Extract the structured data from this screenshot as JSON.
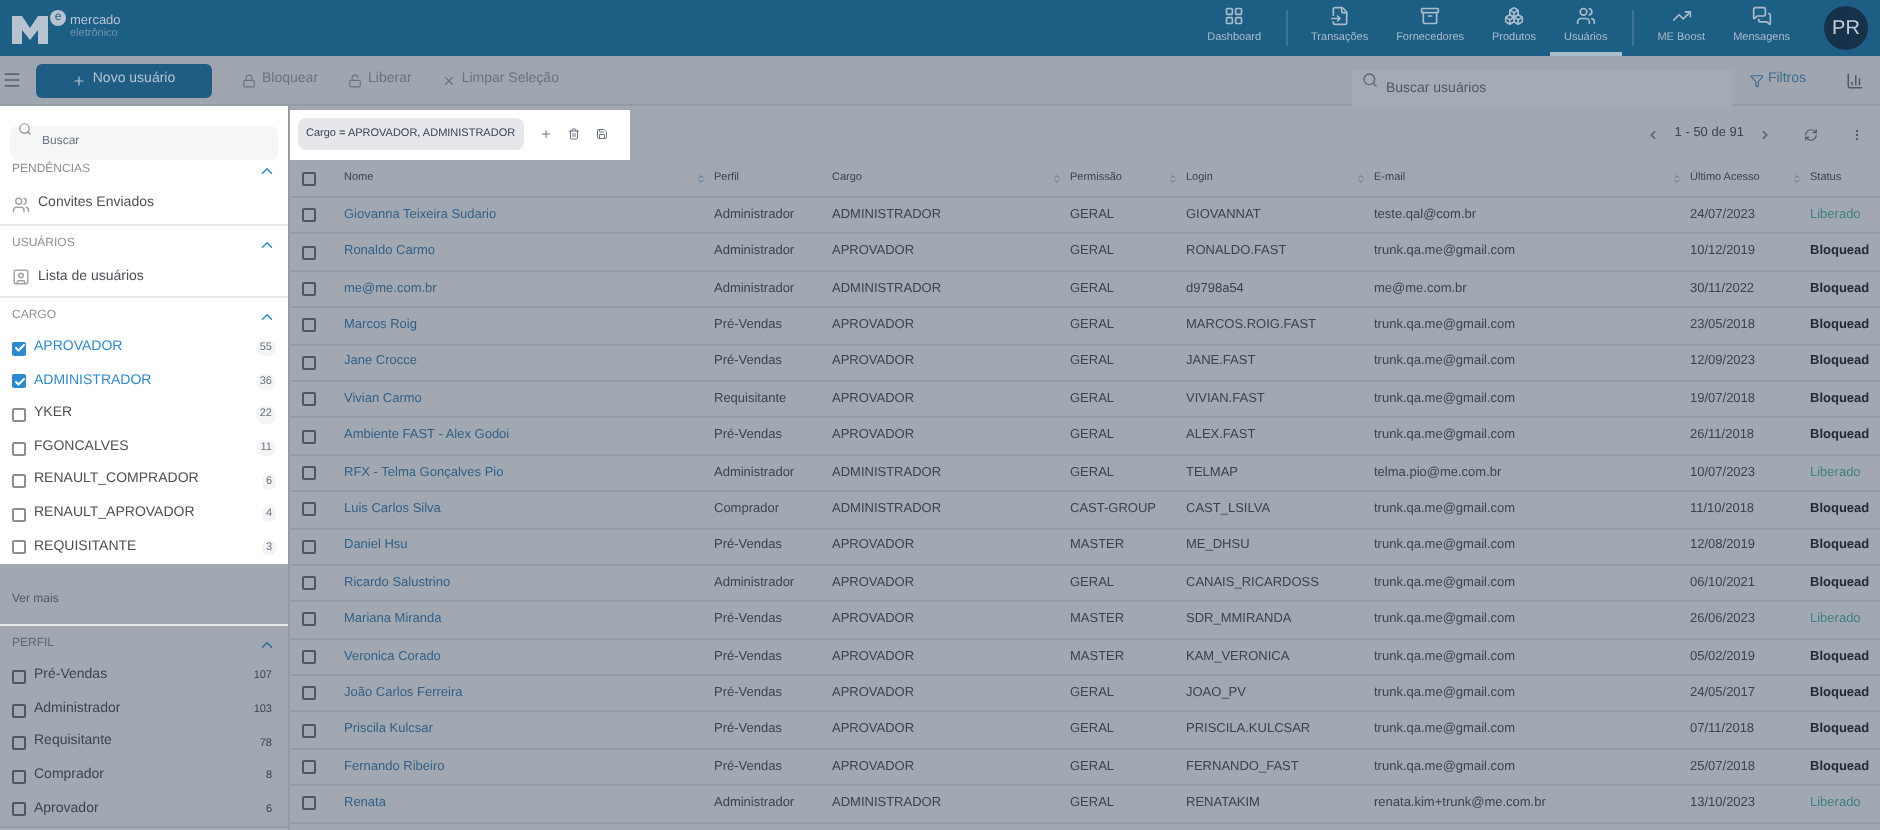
{
  "brand": {
    "line_1": "mercado",
    "line_2": "eletrônico",
    "mark": "e"
  },
  "nav": [
    {
      "label": "Dashboard",
      "selected": false
    },
    {
      "label": "Transações",
      "selected": false
    },
    {
      "label": "Fornecedores",
      "selected": false
    },
    {
      "label": "Produtos",
      "selected": false
    },
    {
      "label": "Usuários",
      "selected": true
    },
    {
      "label": "ME Boost",
      "selected": false
    },
    {
      "label": "Mensagens",
      "selected": false
    }
  ],
  "avatar": "PR",
  "toolbar": {
    "new_button": "Novo usuário",
    "actions": [
      {
        "label": "Bloquear"
      },
      {
        "label": "Liberar"
      },
      {
        "label": "Limpar Seleção"
      }
    ],
    "search": {
      "placeholder": "Buscar usuários"
    },
    "filters": "Filtros"
  },
  "sidebar": {
    "search": {
      "placeholder": "Buscar"
    },
    "sections": [
      {
        "title": "PENDÊNCIAS",
        "highlighted": true,
        "links": [
          {
            "label": "Convites Enviados"
          }
        ]
      },
      {
        "title": "USUÁRIOS",
        "highlighted": true,
        "links": [
          {
            "label": "Lista de usuários"
          }
        ]
      },
      {
        "title": "CARGO",
        "highlighted": true,
        "options": [
          {
            "label": "APROVADOR",
            "count": "55",
            "checked": true
          },
          {
            "label": "ADMINISTRADOR",
            "count": "36",
            "checked": true
          },
          {
            "label": "YKER",
            "count": "22",
            "checked": false
          },
          {
            "label": "FGONCALVES",
            "count": "11",
            "checked": false
          },
          {
            "label": "RENAULT_COMPRADOR",
            "count": "6",
            "checked": false
          },
          {
            "label": "RENAULT_APROVADOR",
            "count": "4",
            "checked": false
          },
          {
            "label": "REQUISITANTE",
            "count": "3",
            "checked": false
          }
        ],
        "more": "Ver mais"
      },
      {
        "title": "PERFIL",
        "highlighted": false,
        "options": [
          {
            "label": "Pré-Vendas",
            "count": "107",
            "checked": false
          },
          {
            "label": "Administrador",
            "count": "103",
            "checked": false
          },
          {
            "label": "Requisitante",
            "count": "78",
            "checked": false
          },
          {
            "label": "Comprador",
            "count": "8",
            "checked": false
          },
          {
            "label": "Aprovador",
            "count": "6",
            "checked": false
          }
        ]
      }
    ]
  },
  "filter_chip": "Cargo = APROVADOR, ADMINISTRADOR",
  "pagination": "1 - 50 de 91",
  "table": {
    "all_checked": false,
    "columns": [
      "Nome",
      "Perfil",
      "Cargo",
      "Permissão",
      "Login",
      "E-mail",
      "Último Acesso",
      "Status"
    ],
    "rows": [
      {
        "cells": [
          "Giovanna Teixeira Sudario",
          "Administrador",
          "ADMINISTRADOR",
          "GERAL",
          "GIOVANNAT",
          "teste.qal@com.br",
          "24/07/2023",
          "Liberado"
        ],
        "kind": "released",
        "checked": false
      },
      {
        "cells": [
          "Ronaldo Carmo",
          "Administrador",
          "APROVADOR",
          "GERAL",
          "RONALDO.FAST",
          "trunk.qa.me@gmail.com",
          "10/12/2019",
          "Bloquead"
        ],
        "kind": "blocked",
        "checked": false
      },
      {
        "cells": [
          "me@me.com.br",
          "Administrador",
          "ADMINISTRADOR",
          "GERAL",
          "d9798a54",
          "me@me.com.br",
          "30/11/2022",
          "Bloquead"
        ],
        "kind": "blocked",
        "checked": false
      },
      {
        "cells": [
          "Marcos Roig",
          "Pré-Vendas",
          "APROVADOR",
          "GERAL",
          "MARCOS.ROIG.FAST",
          "trunk.qa.me@gmail.com",
          "23/05/2018",
          "Bloquead"
        ],
        "kind": "blocked",
        "checked": false
      },
      {
        "cells": [
          "Jane Crocce",
          "Pré-Vendas",
          "APROVADOR",
          "GERAL",
          "JANE.FAST",
          "trunk.qa.me@gmail.com",
          "12/09/2023",
          "Bloquead"
        ],
        "kind": "blocked",
        "checked": false
      },
      {
        "cells": [
          "Vivian Carmo",
          "Requisitante",
          "APROVADOR",
          "GERAL",
          "VIVIAN.FAST",
          "trunk.qa.me@gmail.com",
          "19/07/2018",
          "Bloquead"
        ],
        "kind": "blocked",
        "checked": false
      },
      {
        "cells": [
          "Ambiente FAST - Alex Godoi",
          "Pré-Vendas",
          "APROVADOR",
          "GERAL",
          "ALEX.FAST",
          "trunk.qa.me@gmail.com",
          "26/11/2018",
          "Bloquead"
        ],
        "kind": "blocked",
        "checked": false
      },
      {
        "cells": [
          "RFX - Telma Gonçalves Pio",
          "Administrador",
          "ADMINISTRADOR",
          "GERAL",
          "TELMAP",
          "telma.pio@me.com.br",
          "10/07/2023",
          "Liberado"
        ],
        "kind": "released",
        "checked": false
      },
      {
        "cells": [
          "Luis Carlos Silva",
          "Comprador",
          "ADMINISTRADOR",
          "CAST-GROUP",
          "CAST_LSILVA",
          "trunk.qa.me@gmail.com",
          "11/10/2018",
          "Bloquead"
        ],
        "kind": "blocked",
        "checked": false
      },
      {
        "cells": [
          "Daniel Hsu",
          "Pré-Vendas",
          "APROVADOR",
          "MASTER",
          "ME_DHSU",
          "trunk.qa.me@gmail.com",
          "12/08/2019",
          "Bloquead"
        ],
        "kind": "blocked",
        "checked": false
      },
      {
        "cells": [
          "Ricardo Salustrino",
          "Administrador",
          "APROVADOR",
          "GERAL",
          "CANAIS_RICARDOSS",
          "trunk.qa.me@gmail.com",
          "06/10/2021",
          "Bloquead"
        ],
        "kind": "blocked",
        "checked": false
      },
      {
        "cells": [
          "Mariana Miranda",
          "Pré-Vendas",
          "APROVADOR",
          "MASTER",
          "SDR_MMIRANDA",
          "trunk.qa.me@gmail.com",
          "26/06/2023",
          "Liberado"
        ],
        "kind": "released",
        "checked": false
      },
      {
        "cells": [
          "Veronica Corado",
          "Pré-Vendas",
          "APROVADOR",
          "MASTER",
          "KAM_VERONICA",
          "trunk.qa.me@gmail.com",
          "05/02/2019",
          "Bloquead"
        ],
        "kind": "blocked",
        "checked": false
      },
      {
        "cells": [
          "João Carlos Ferreira",
          "Pré-Vendas",
          "APROVADOR",
          "GERAL",
          "JOAO_PV",
          "trunk.qa.me@gmail.com",
          "24/05/2017",
          "Bloquead"
        ],
        "kind": "blocked",
        "checked": false
      },
      {
        "cells": [
          "Priscila Kulcsar",
          "Pré-Vendas",
          "APROVADOR",
          "GERAL",
          "PRISCILA.KULCSAR",
          "trunk.qa.me@gmail.com",
          "07/11/2018",
          "Bloquead"
        ],
        "kind": "blocked",
        "checked": false
      },
      {
        "cells": [
          "Fernando Ribeiro",
          "Pré-Vendas",
          "APROVADOR",
          "GERAL",
          "FERNANDO_FAST",
          "trunk.qa.me@gmail.com",
          "25/07/2018",
          "Bloquead"
        ],
        "kind": "blocked",
        "checked": false
      },
      {
        "cells": [
          "Renata",
          "Administrador",
          "ADMINISTRADOR",
          "GERAL",
          "RENATAKIM",
          "renata.kim+trunk@me.com.br",
          "13/10/2023",
          "Liberado"
        ],
        "kind": "released",
        "checked": false
      }
    ]
  }
}
